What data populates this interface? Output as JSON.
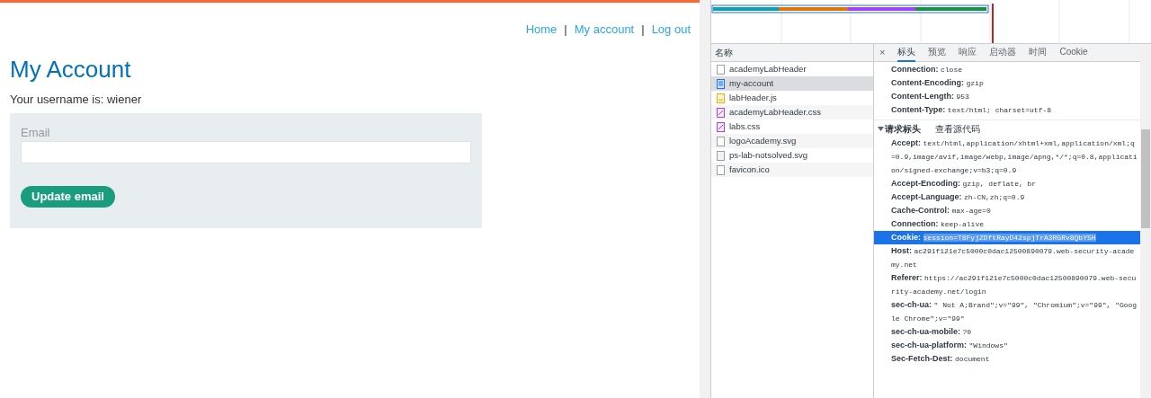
{
  "site": {
    "nav": [
      {
        "label": "Home"
      },
      {
        "label": "My account"
      },
      {
        "label": "Log out"
      }
    ],
    "separator": "|",
    "title": "My Account",
    "username_line": "Your username is: wiener",
    "form": {
      "label": "Email",
      "button": "Update email"
    }
  },
  "devtools": {
    "name_header": "名称",
    "files": [
      {
        "name": "academyLabHeader",
        "kind": "doc",
        "selected": false
      },
      {
        "name": "my-account",
        "kind": "page",
        "selected": true
      },
      {
        "name": "labHeader.js",
        "kind": "script",
        "selected": false
      },
      {
        "name": "academyLabHeader.css",
        "kind": "style",
        "selected": false
      },
      {
        "name": "labs.css",
        "kind": "style",
        "selected": false
      },
      {
        "name": "logoAcademy.svg",
        "kind": "image",
        "selected": false
      },
      {
        "name": "ps-lab-notsolved.svg",
        "kind": "svg",
        "selected": false
      },
      {
        "name": "favicon.ico",
        "kind": "doc",
        "selected": false
      }
    ],
    "close": "×",
    "tabs": [
      {
        "label": "标头",
        "selected": true
      },
      {
        "label": "预览",
        "selected": false
      },
      {
        "label": "响应",
        "selected": false
      },
      {
        "label": "启动器",
        "selected": false
      },
      {
        "label": "时间",
        "selected": false
      },
      {
        "label": "Cookie",
        "selected": false
      }
    ],
    "response_headers": [
      {
        "name": "Connection:",
        "value": "close",
        "selected": false
      },
      {
        "name": "Content-Encoding:",
        "value": "gzip",
        "selected": false
      },
      {
        "name": "Content-Length:",
        "value": "953",
        "selected": false
      },
      {
        "name": "Content-Type:",
        "value": "text/html; charset=utf-8",
        "selected": false
      }
    ],
    "request_section": {
      "title": "请求标头",
      "expanded": true,
      "view_source": "查看源代码"
    },
    "request_headers": [
      {
        "name": "Accept:",
        "value": "text/html,application/xhtml+xml,application/xml;q=0.9,image/avif,image/webp,image/apng,*/*;q=0.8,application/signed-exchange;v=b3;q=0.9",
        "selected": false
      },
      {
        "name": "Accept-Encoding:",
        "value": "gzip, deflate, br",
        "selected": false
      },
      {
        "name": "Accept-Language:",
        "value": "zh-CN,zh;q=0.9",
        "selected": false
      },
      {
        "name": "Cache-Control:",
        "value": "max-age=0",
        "selected": false
      },
      {
        "name": "Connection:",
        "value": "keep-alive",
        "selected": false
      },
      {
        "name": "Cookie:",
        "value": "session=T8FyjZDftRayD42spjTrA3RGRv8QbY5H",
        "selected": true
      },
      {
        "name": "Host:",
        "value": "ac291f121e7c5000c0dac12500890079.web-security-academy.net",
        "selected": false
      },
      {
        "name": "Referer:",
        "value": "https://ac291f121e7c5000c0dac12500890079.web-security-academy.net/login",
        "selected": false
      },
      {
        "name": "sec-ch-ua:",
        "value": "\" Not A;Brand\";v=\"99\", \"Chromium\";v=\"99\", \"Google Chrome\";v=\"99\"",
        "selected": false
      },
      {
        "name": "sec-ch-ua-mobile:",
        "value": "?0",
        "selected": false
      },
      {
        "name": "sec-ch-ua-platform:",
        "value": "\"Windows\"",
        "selected": false
      },
      {
        "name": "Sec-Fetch-Dest:",
        "value": "document",
        "selected": false
      }
    ]
  }
}
